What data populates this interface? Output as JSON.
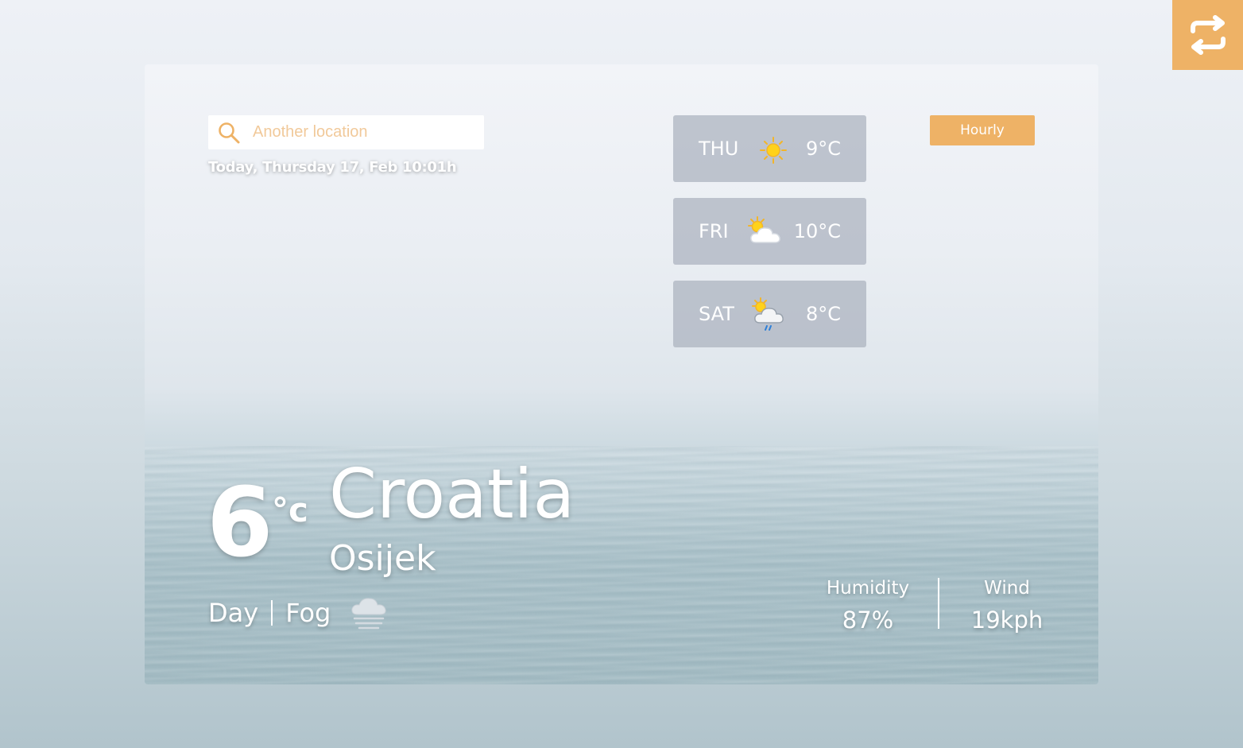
{
  "search": {
    "placeholder": "Another location",
    "date_line": "Today, Thursday 17, Feb 10:01h"
  },
  "forecast": [
    {
      "day": "THU",
      "temp": "9°C",
      "icon": "sun-icon"
    },
    {
      "day": "FRI",
      "temp": "10°C",
      "icon": "partly-cloudy-icon"
    },
    {
      "day": "SAT",
      "temp": "8°C",
      "icon": "sun-cloud-rain-icon"
    }
  ],
  "hourly_label": "Hourly",
  "current": {
    "temp": "6",
    "unit": "°c",
    "country": "Croatia",
    "city": "Osijek",
    "period": "Day",
    "condition": "Fog",
    "condition_icon": "fog-icon"
  },
  "stats": {
    "humidity_label": "Humidity",
    "humidity_value": "87%",
    "wind_label": "Wind",
    "wind_value": "19kph"
  },
  "colors": {
    "accent": "#eeb266",
    "tile_bg": "#b3bac5",
    "text": "#ffffff"
  },
  "icons": {
    "swap": "swap-arrows-icon",
    "search": "search-icon"
  }
}
